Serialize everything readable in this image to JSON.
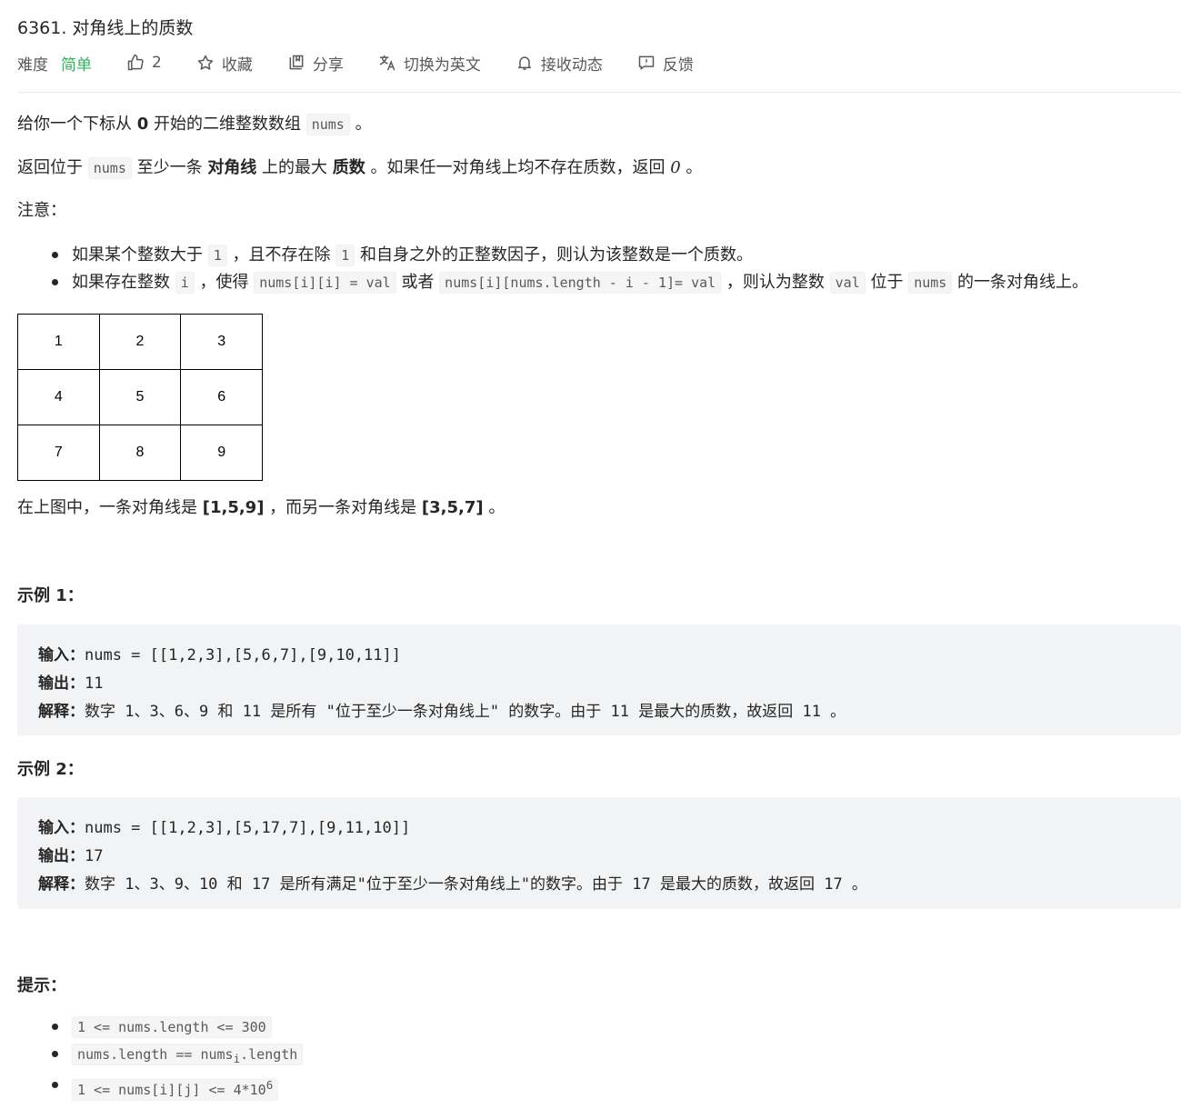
{
  "problem": {
    "title": "6361. 对角线上的质数",
    "difficulty_label": "难度",
    "difficulty_value": "简单",
    "likes": "2",
    "actions": {
      "collect": "收藏",
      "share": "分享",
      "switch_lang": "切换为英文",
      "subscribe": "接收动态",
      "feedback": "反馈"
    }
  },
  "colors": {
    "difficulty_easy": "#2db55d",
    "code_bg": "#f5f5f5",
    "example_bg": "#f2f3f4"
  },
  "icons": [
    "thumb-up-icon",
    "star-icon",
    "share-icon",
    "translate-icon",
    "bell-icon",
    "feedback-icon"
  ],
  "description": {
    "p1_a": "给你一个下标从 ",
    "p1_b": "0",
    "p1_c": " 开始的二维整数数组 ",
    "p1_code": "nums",
    "p1_d": " 。",
    "p2_a": "返回位于 ",
    "p2_code": "nums",
    "p2_b": " 至少一条 ",
    "p2_c": "对角线",
    "p2_d": " 上的最大 ",
    "p2_e": "质数",
    "p2_f": " 。如果任一对角线上均不存在质数，返回 ",
    "p2_g": "0",
    "p2_h": " 。",
    "note": "注意：",
    "b1_a": "如果某个整数大于 ",
    "b1_code1": "1",
    "b1_b": " ，且不存在除 ",
    "b1_code2": "1",
    "b1_c": " 和自身之外的正整数因子，则认为该整数是一个质数。",
    "b2_a": "如果存在整数 ",
    "b2_code1": "i",
    "b2_b": " ，使得 ",
    "b2_code2": "nums[i][i] = val",
    "b2_c": " 或者 ",
    "b2_code3": "nums[i][nums.length - i - 1]= val",
    "b2_d": " ，则认为整数 ",
    "b2_code4": "val",
    "b2_e": " 位于 ",
    "b2_code5": "nums",
    "b2_f": " 的一条对角线上。",
    "grid": [
      [
        "1",
        "2",
        "3"
      ],
      [
        "4",
        "5",
        "6"
      ],
      [
        "7",
        "8",
        "9"
      ]
    ],
    "caption_a": "在上图中，一条对角线是 ",
    "caption_b": "[1,5,9]",
    "caption_c": " ，而另一条对角线是 ",
    "caption_d": "[3,5,7]",
    "caption_e": " 。"
  },
  "examples": [
    {
      "heading": "示例 1：",
      "input_label": "输入：",
      "input_value": "nums = [[1,2,3],[5,6,7],[9,10,11]]",
      "output_label": "输出：",
      "output_value": "11",
      "explain_label": "解释：",
      "explain_value": "数字 1、3、6、9 和 11 是所有 \"位于至少一条对角线上\" 的数字。由于 11 是最大的质数，故返回 11 。"
    },
    {
      "heading": "示例 2：",
      "input_label": "输入：",
      "input_value": "nums = [[1,2,3],[5,17,7],[9,11,10]]",
      "output_label": "输出：",
      "output_value": "17",
      "explain_label": "解释：",
      "explain_value": "数字 1、3、9、10 和 17 是所有满足\"位于至少一条对角线上\"的数字。由于 17 是最大的质数，故返回 17 。"
    }
  ],
  "constraints": {
    "heading": "提示：",
    "c1": "1 <= nums.length <= 300",
    "c2_a": "nums.length == nums",
    "c2_sub": "i",
    "c2_b": ".length",
    "c3_a": "1 <= nums[i][j]  <= 4*10",
    "c3_sup": "6"
  }
}
